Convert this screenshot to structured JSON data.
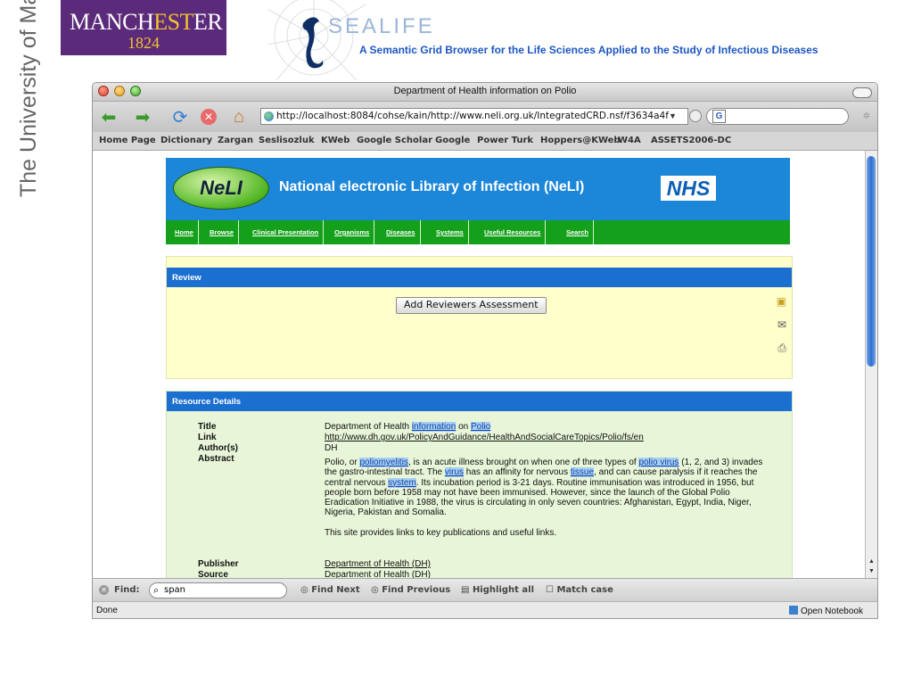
{
  "slide": {
    "manchester_logo": {
      "text_before": "MANCH",
      "text_highlight": "EST",
      "text_after": "ER",
      "year": "1824"
    },
    "university_vertical": "The University of Manchester",
    "sealife_title": "SEALIFE",
    "tagline": "A Semantic Grid Browser for the Life Sciences Applied to the Study of Infectious Diseases"
  },
  "browser": {
    "window_title": "Department of Health information on Polio",
    "url": "http://localhost:8084/cohse/kain/http://www.neli.org.uk/IntegratedCRD.nsf/f3634a4f",
    "search_value": "",
    "bookmarks": [
      "Home Page",
      "Dictionary",
      "Zargan",
      "Seslisozluk",
      "KWeb",
      "Google Scholar",
      "Google",
      "Power Turk",
      "Hoppers@KWeb",
      "W4A",
      "ASSETS2006-DC"
    ],
    "find_bar": {
      "label": "Find:",
      "value": "span",
      "find_next": "Find Next",
      "find_previous": "Find Previous",
      "highlight_all": "Highlight all",
      "match_case": "Match case"
    },
    "status": "Done",
    "notebook": "Open Notebook"
  },
  "neli": {
    "logo": "NeLI",
    "title": "National electronic Library of Infection (NeLI)",
    "nhs": "NHS",
    "nav": [
      "Home",
      "Browse",
      "Clinical Presentation",
      "Organisms",
      "Diseases",
      "Systems",
      "Useful Resources",
      "Search"
    ],
    "review": {
      "heading": "Review",
      "button": "Add Reviewers Assessment"
    },
    "details": {
      "heading": "Resource Details",
      "labels": {
        "title": "Title",
        "link": "Link",
        "author": "Author(s)",
        "abstract": "Abstract",
        "publisher": "Publisher",
        "source": "Source"
      },
      "title_parts": {
        "t1": "Department of Health ",
        "t2": "information",
        "t3": " on ",
        "t4": "Polio"
      },
      "link": "http://www.dh.gov.uk/PolicyAndGuidance/HealthAndSocialCareTopics/Polio/fs/en",
      "author": "DH",
      "abstract_parts": {
        "a1": "Polio, or ",
        "a2": "poliomyelitis",
        "a3": ", is an acute illness brought on when one of three types of ",
        "a4": "polio virus",
        "a5": " (1, 2, and 3) invades the gastro-intestinal tract. The ",
        "a6": "virus",
        "a7": " has an affinity for nervous ",
        "a8": "tissue",
        "a9": ", and can cause paralysis if it reaches the central nervous ",
        "a10": "system",
        "a11": ". Its incubation period is 3-21 days. Routine immunisation was introduced in 1956, but people born before 1958 may not have been immunised. However, since the launch of the Global Polio Eradication Initiative in 1988, the virus is circulating in only seven countries: Afghanistan, Egypt, India, Niger, Nigeria, Pakistan and Somalia."
      },
      "abstract_extra": "This site provides links to key publications and useful links.",
      "publisher": "Department of Health (DH)",
      "source": "Department of Health (DH)"
    }
  }
}
